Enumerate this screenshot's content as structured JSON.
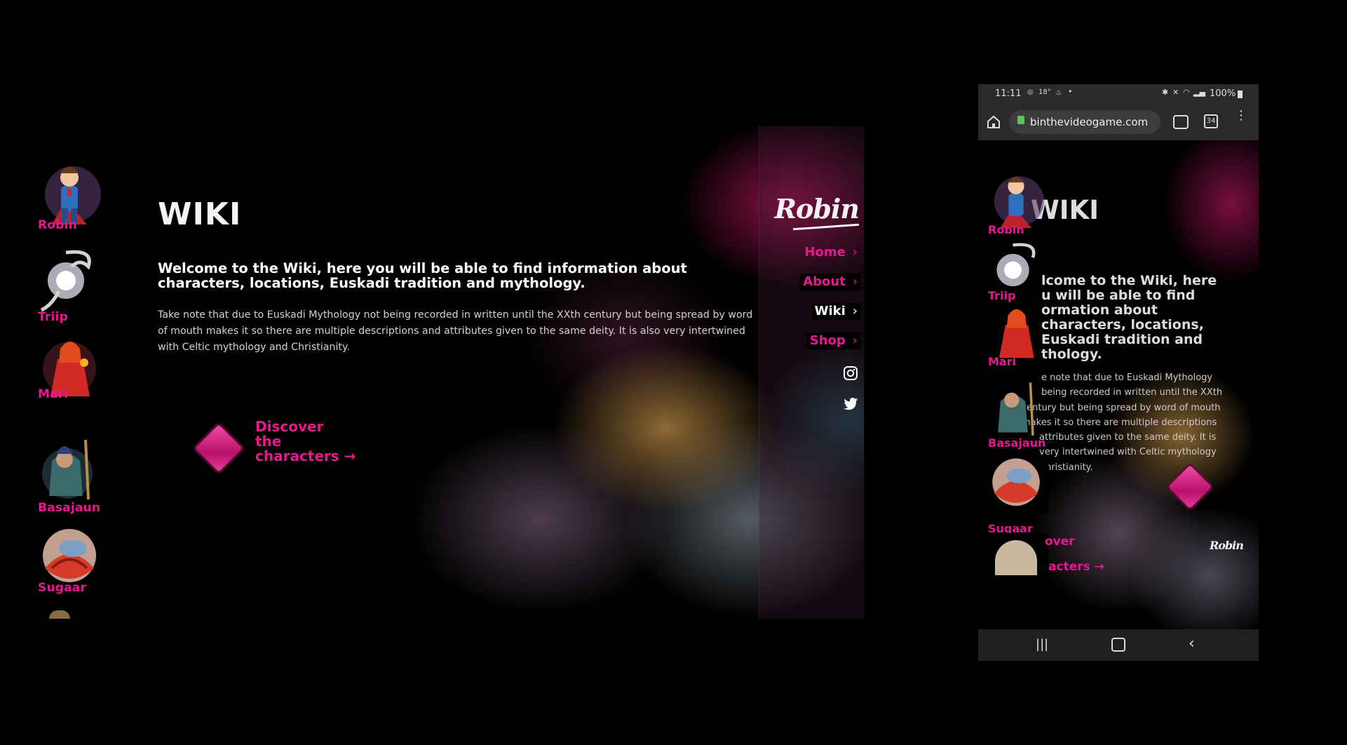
{
  "characters": [
    {
      "name": "Robin",
      "icon": "robin-character-icon"
    },
    {
      "name": "Triip",
      "icon": "triip-character-icon"
    },
    {
      "name": "Mari",
      "icon": "mari-character-icon"
    },
    {
      "name": "Basajaun",
      "icon": "basajaun-character-icon"
    },
    {
      "name": "Sugaar",
      "icon": "sugaar-character-icon"
    }
  ],
  "page": {
    "title": "WIKI",
    "intro": "Welcome to the Wiki, here you will be able to find information about characters, locations, Euskadi tradition and mythology.",
    "body": "Take note that due to Euskadi Mythology not being recorded in written until the XXth century but being spread by word of mouth makes it so there are multiple descriptions and attributes given to the same deity. It is also very intertwined with Celtic mythology and Christianity.",
    "cta": {
      "line1": "Discover",
      "line2": "the",
      "line3": "characters →"
    }
  },
  "logo": "Robin",
  "nav": [
    {
      "label": "Home",
      "active": false
    },
    {
      "label": "About",
      "active": true
    },
    {
      "label": "Wiki",
      "active": true
    },
    {
      "label": "Shop",
      "active": true
    }
  ],
  "social": [
    "instagram-icon",
    "twitter-icon"
  ],
  "phone": {
    "status": {
      "time": "11:11",
      "temp": "18°",
      "battery": "100%"
    },
    "url": "binthevideogame.com",
    "tab_count": "34",
    "title_visible": "WIKI",
    "intro_lines": [
      "lcome to the Wiki, here",
      "u will be able to find",
      "ormation about",
      "characters, locations,",
      "Euskadi tradition and",
      "thology."
    ],
    "body_lines": [
      "e note that due to Euskadi Mythology",
      "being recorded in written until the XXth",
      "century but being spread by word of mouth",
      "makes it so there are multiple descriptions",
      "attributes given to the same deity. It is",
      "very intertwined with Celtic mythology",
      "Christianity."
    ],
    "cta_partial_1": "over",
    "cta_partial_2": "acters →"
  },
  "colors": {
    "accent": "#e8168f",
    "background": "#000000",
    "text": "#ffffff"
  }
}
